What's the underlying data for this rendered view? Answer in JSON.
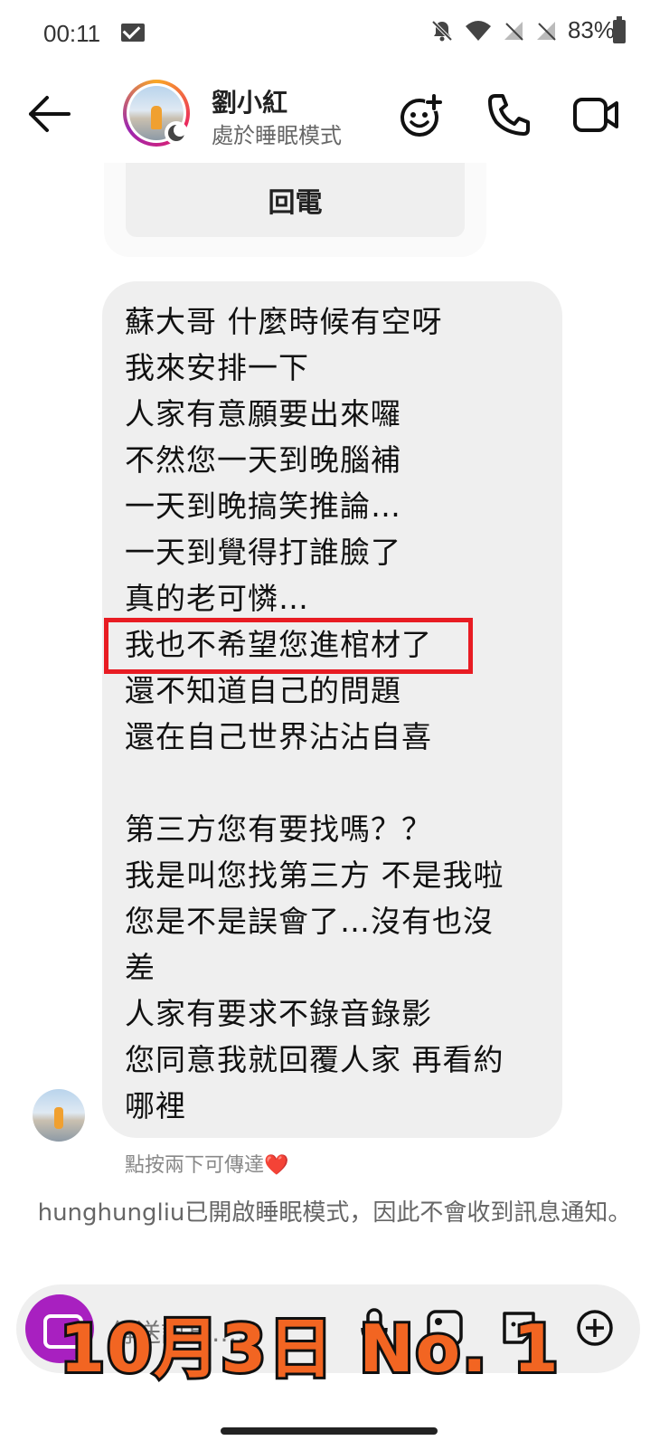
{
  "status_bar": {
    "time": "00:11",
    "battery": "83%",
    "icons": [
      "mail-icon",
      "bell-muted-icon",
      "wifi-icon",
      "signal-icon",
      "signal-icon",
      "battery-icon"
    ]
  },
  "header": {
    "contact_name": "劉小紅",
    "contact_status": "處於睡眠模式",
    "icons": [
      "back-arrow-icon",
      "effects-icon",
      "phone-icon",
      "video-icon"
    ]
  },
  "call_card": {
    "button_label": "回電"
  },
  "message": {
    "lines": [
      "蘇大哥 什麼時候有空呀",
      "我來安排一下",
      "人家有意願要出來囉",
      "不然您一天到晚腦補",
      "一天到晚搞笑推論…",
      "一天到覺得打誰臉了",
      "真的老可憐…",
      "我也不希望您進棺材了",
      "還不知道自己的問題",
      "還在自己世界沾沾自喜",
      "",
      "第三方您有要找嗎？？",
      "我是叫您找第三方 不是我啦",
      "您是不是誤會了…沒有也沒",
      "差",
      "人家有要求不錄音錄影",
      "您同意我就回覆人家 再看約",
      "哪裡"
    ],
    "highlight_color": "#e81c23"
  },
  "double_tap_hint": "點按兩下可傳達❤️",
  "sleep_notice": "hunghungliu已開啟睡眠模式，因此不會收到訊息通知。",
  "composer": {
    "placeholder": "傳送訊息……"
  },
  "overlay_caption": "10月3日  No. 1",
  "colors": {
    "accent_purple": "#a820c0",
    "caption_orange": "#f26522",
    "bubble_bg": "#efefef"
  }
}
